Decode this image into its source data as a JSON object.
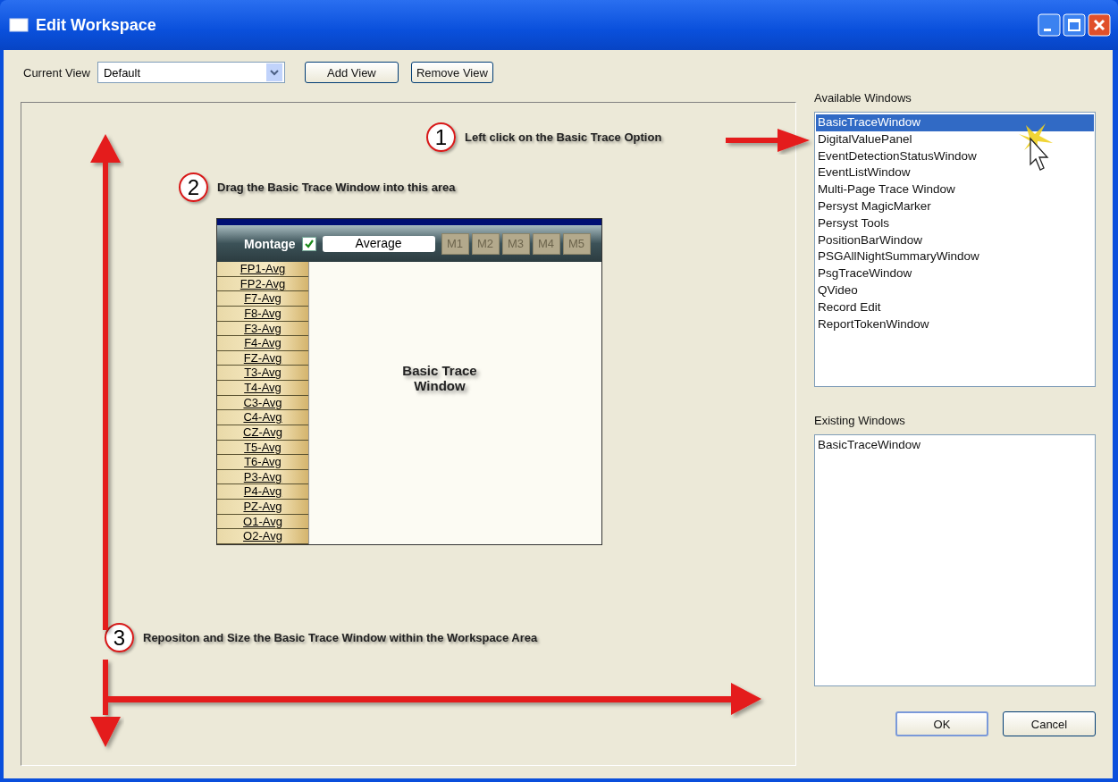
{
  "window": {
    "title": "Edit Workspace"
  },
  "toolbar": {
    "current_view_label": "Current View",
    "current_view_value": "Default",
    "buttons": [
      "Add View",
      "Remove View"
    ]
  },
  "workspace": {
    "annotations": [
      {
        "number": "1",
        "text": "Left click on the Basic Trace Option"
      },
      {
        "number": "2",
        "text": "Drag the Basic Trace Window into this area"
      },
      {
        "number": "3",
        "text": "Repositon and Size the Basic Trace Window within the Workspace Area"
      }
    ],
    "trace_window": {
      "montage_label": "Montage",
      "montage_checked": true,
      "montage_value": "Average",
      "montage_buttons": [
        "M1",
        "M2",
        "M3",
        "M4",
        "M5"
      ],
      "channels": [
        "FP1-Avg",
        "FP2-Avg",
        "F7-Avg",
        "F8-Avg",
        "F3-Avg",
        "F4-Avg",
        "FZ-Avg",
        "T3-Avg",
        "T4-Avg",
        "C3-Avg",
        "C4-Avg",
        "CZ-Avg",
        "T5-Avg",
        "T6-Avg",
        "P3-Avg",
        "P4-Avg",
        "PZ-Avg",
        "O1-Avg",
        "O2-Avg"
      ],
      "caption": "Basic Trace Window"
    }
  },
  "available_windows": {
    "label": "Available Windows",
    "items": [
      {
        "label": "BasicTraceWindow",
        "selected": true
      },
      {
        "label": "DigitalValuePanel",
        "selected": false
      },
      {
        "label": "EventDetectionStatusWindow",
        "selected": false
      },
      {
        "label": "EventListWindow",
        "selected": false
      },
      {
        "label": "Multi-Page Trace Window",
        "selected": false
      },
      {
        "label": "Persyst MagicMarker",
        "selected": false
      },
      {
        "label": "Persyst Tools",
        "selected": false
      },
      {
        "label": "PositionBarWindow",
        "selected": false
      },
      {
        "label": "PSGAllNightSummaryWindow",
        "selected": false
      },
      {
        "label": "PsgTraceWindow",
        "selected": false
      },
      {
        "label": "QVideo",
        "selected": false
      },
      {
        "label": "Record Edit",
        "selected": false
      },
      {
        "label": "ReportTokenWindow",
        "selected": false
      }
    ]
  },
  "existing_windows": {
    "label": "Existing Windows",
    "items": [
      "BasicTraceWindow"
    ]
  },
  "buttons": [
    "OK",
    "Cancel"
  ]
}
